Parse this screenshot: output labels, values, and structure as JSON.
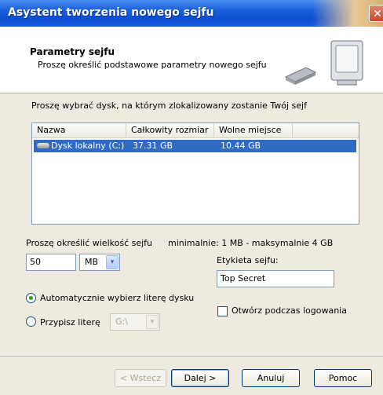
{
  "window": {
    "title": "Asystent tworzenia nowego sejfu",
    "close_glyph": "✕"
  },
  "header": {
    "title": "Parametry sejfu",
    "subtitle": "Proszę określić podstawowe parametry nowego sejfu"
  },
  "disk": {
    "prompt": "Proszę wybrać dysk, na którym zlokalizowany zostanie Twój sejf",
    "columns": [
      "Nazwa",
      "Całkowity rozmiar",
      "Wolne miejsce"
    ],
    "rows": [
      {
        "name": "Dysk lokalny (C:)",
        "total": "37.31 GB",
        "free": "10.44 GB",
        "selected": true
      }
    ]
  },
  "size": {
    "label": "Proszę określić wielkość sejfu",
    "limits": "minimalnie: 1  MB -  maksymalnie 4 GB",
    "value": "50",
    "unit": "MB"
  },
  "label_field": {
    "label": "Etykieta sejfu:",
    "value": "Top Secret"
  },
  "drive_letter": {
    "auto_label": "Automatycznie wybierz literę dysku",
    "manual_label": "Przypisz literę",
    "letter": "G:\\",
    "selected": "auto"
  },
  "open_on_login": {
    "label": "Otwórz podczas logowania",
    "checked": false
  },
  "buttons": {
    "back": "< Wstecz",
    "next": "Dalej >",
    "cancel": "Anuluj",
    "help": "Pomoc"
  },
  "icons": {
    "dropdown": "▾",
    "close": "close-icon",
    "drive": "hard-drive-icon",
    "computer": "computer-safe-icon"
  }
}
